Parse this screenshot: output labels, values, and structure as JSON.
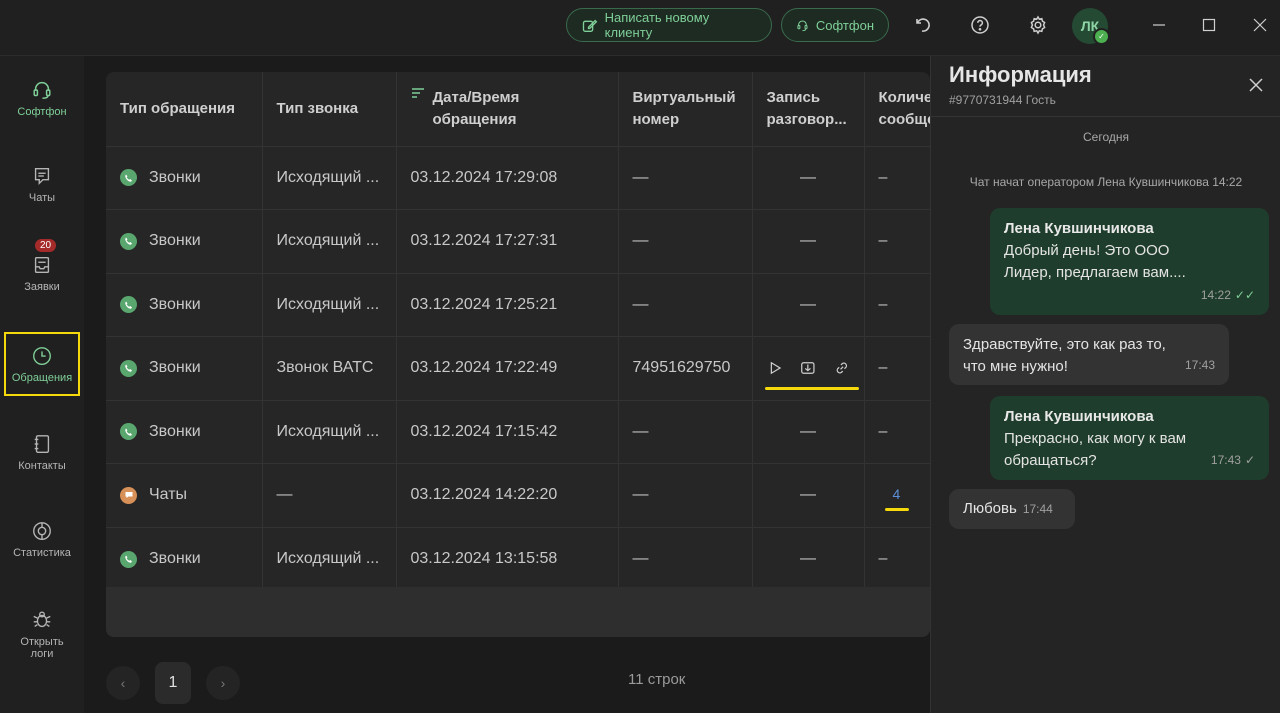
{
  "topbar": {
    "new_client_label": "Написать новому клиенту",
    "softphone_label": "Софтфон",
    "avatar_initials": "ЛК"
  },
  "sidebar": {
    "items": [
      {
        "label": "Софтфон"
      },
      {
        "label": "Чаты"
      },
      {
        "label": "Заявки",
        "badge": "20"
      },
      {
        "label": "Обращения"
      },
      {
        "label": "Контакты"
      },
      {
        "label": "Статистика"
      },
      {
        "label": "Открыть логи"
      }
    ]
  },
  "table": {
    "headers": [
      "Тип обращения",
      "Тип звонка",
      "Дата/Время обращения",
      "Виртуальный номер",
      "Запись разговор...",
      "Количество сообщений"
    ],
    "rows": [
      {
        "type": "Звонки",
        "kind": "call",
        "call_type": "Исходящий ...",
        "datetime": "03.12.2024 17:29:08",
        "virtual": "—",
        "record": "—",
        "messages": "–"
      },
      {
        "type": "Звонки",
        "kind": "call",
        "call_type": "Исходящий ...",
        "datetime": "03.12.2024 17:27:31",
        "virtual": "—",
        "record": "—",
        "messages": "–"
      },
      {
        "type": "Звонки",
        "kind": "call",
        "call_type": "Исходящий ...",
        "datetime": "03.12.2024 17:25:21",
        "virtual": "—",
        "record": "—",
        "messages": "–"
      },
      {
        "type": "Звонки",
        "kind": "call",
        "call_type": "Звонок ВАТС",
        "datetime": "03.12.2024 17:22:49",
        "virtual": "74951629750",
        "record": "",
        "messages": "–"
      },
      {
        "type": "Звонки",
        "kind": "call",
        "call_type": "Исходящий ...",
        "datetime": "03.12.2024 17:15:42",
        "virtual": "—",
        "record": "—",
        "messages": "–"
      },
      {
        "type": "Чаты",
        "kind": "chat",
        "call_type": "—",
        "datetime": "03.12.2024 14:22:20",
        "virtual": "—",
        "record": "—",
        "messages": "4"
      },
      {
        "type": "Звонки",
        "kind": "call",
        "call_type": "Исходящий ...",
        "datetime": "03.12.2024 13:15:58",
        "virtual": "—",
        "record": "—",
        "messages": "–"
      }
    ]
  },
  "pagination": {
    "prev": "‹",
    "current_page": "1",
    "next": "›",
    "rows_count": "11 строк"
  },
  "info": {
    "title": "Информация",
    "subtitle": "#9770731944 Гость",
    "day": "Сегодня",
    "system_message": "Чат начат оператором Лена Кувшинчикова 14:22",
    "messages": [
      {
        "author": "Лена Кувшинчикова",
        "text": "Добрый день! Это ООО Лидер, предлагаем вам....",
        "time": "14:22"
      },
      {
        "text": "Здравствуйте, это как раз то, что мне нужно!",
        "time": "17:43"
      },
      {
        "author": "Лена Кувшинчикова",
        "text": "Прекрасно, как могу к вам обращаться?",
        "time": "17:43"
      },
      {
        "text": "Любовь",
        "time": "17:44"
      }
    ]
  },
  "colors": {
    "accent": "#7fcf98",
    "highlight": "#f5d90a",
    "outgoing_bubble": "#1f3d2c",
    "incoming_bubble": "#333333"
  }
}
